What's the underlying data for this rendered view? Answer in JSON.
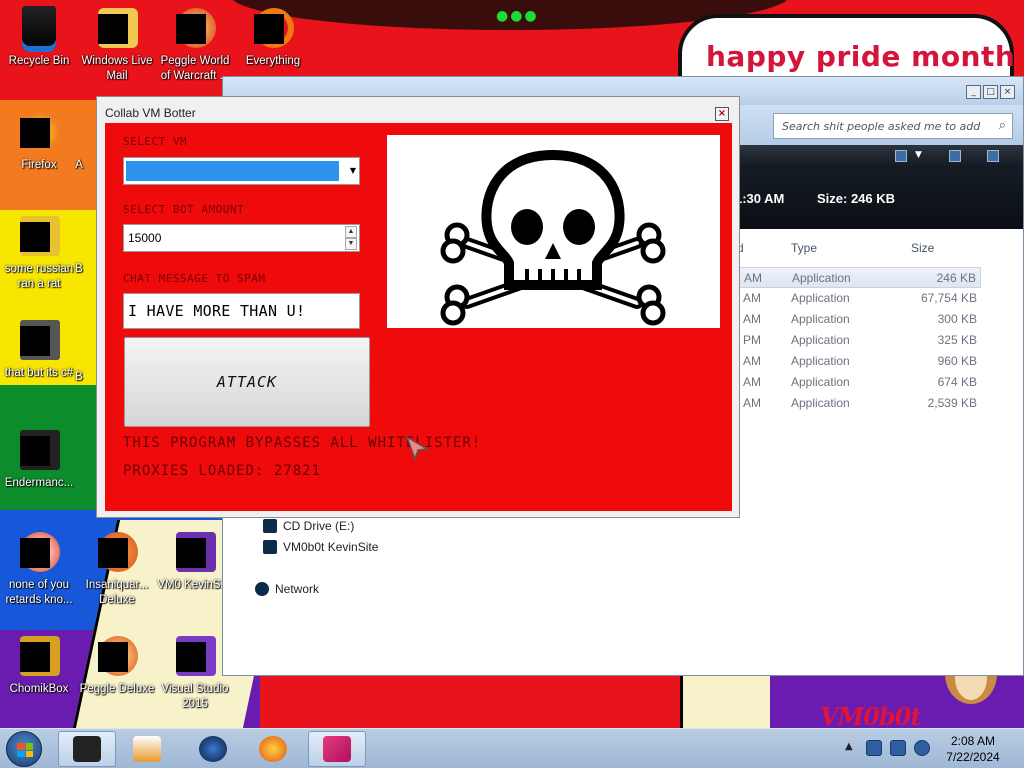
{
  "desktop": {
    "icons": [
      {
        "label": "Recycle Bin"
      },
      {
        "label": "Windows Live Mail"
      },
      {
        "label": "Peggle World of Warcraft ..."
      },
      {
        "label": "Everything"
      },
      {
        "label": "Firefox"
      },
      {
        "label": "some russian ran a rat"
      },
      {
        "label": "that but its c#"
      },
      {
        "label": "Endermanc..."
      },
      {
        "label": "none of you retards kno..."
      },
      {
        "label": "Insaniquar... Deluxe"
      },
      {
        "label": "VM0 KevinSi..."
      },
      {
        "label": "ChomikBox"
      },
      {
        "label": "Peggle Deluxe"
      },
      {
        "label": "Visual Studio 2015"
      }
    ],
    "partial_labels": {
      "a": "A",
      "b1": "B",
      "b2": "B"
    },
    "wallpaper": {
      "sign_text": "happy pride month",
      "brand_text": "VM0b0t"
    }
  },
  "explorer": {
    "search_placeholder": "Search shit people asked me to add",
    "details": {
      "modified_time": "1:30 AM",
      "size_label": "Size: 246 KB"
    },
    "columns": {
      "partial": "d",
      "type": "Type",
      "size": "Size"
    },
    "rows": [
      {
        "time": "AM",
        "type": "Application",
        "size": "246 KB",
        "selected": true
      },
      {
        "time": "AM",
        "type": "Application",
        "size": "67,754 KB",
        "selected": false
      },
      {
        "time": "AM",
        "type": "Application",
        "size": "300 KB",
        "selected": false
      },
      {
        "time": "PM",
        "type": "Application",
        "size": "325 KB",
        "selected": false
      },
      {
        "time": "AM",
        "type": "Application",
        "size": "960 KB",
        "selected": false
      },
      {
        "time": "AM",
        "type": "Application",
        "size": "674 KB",
        "selected": false
      },
      {
        "time": "AM",
        "type": "Application",
        "size": "2,539 KB",
        "selected": false
      }
    ],
    "nav": {
      "cd_drive": "CD Drive (E:)",
      "kevinsite": "VM0b0t KevinSite",
      "network": "Network"
    }
  },
  "botter": {
    "title": "Collab VM Botter",
    "close_glyph": "×",
    "select_vm_label": "SELECT VM",
    "select_bot_label": "SELECT BOT AMOUNT",
    "bot_amount": "15000",
    "chat_label": "CHAT MESSAGE TO SPAM",
    "chat_message": "I HAVE MORE THAN U!",
    "attack_label": "ATTACK",
    "bypass_text": "THIS PROGRAM BYPASSES ALL WHITELISTER!",
    "proxies_text": "PROXIES LOADED: 27821"
  },
  "taskbar": {
    "time": "2:08 AM",
    "date": "7/22/2024"
  },
  "colors": {
    "dialog_red": "#ef0b0b",
    "select_blue": "#2d92ee",
    "sign_text": "#d4143a"
  }
}
